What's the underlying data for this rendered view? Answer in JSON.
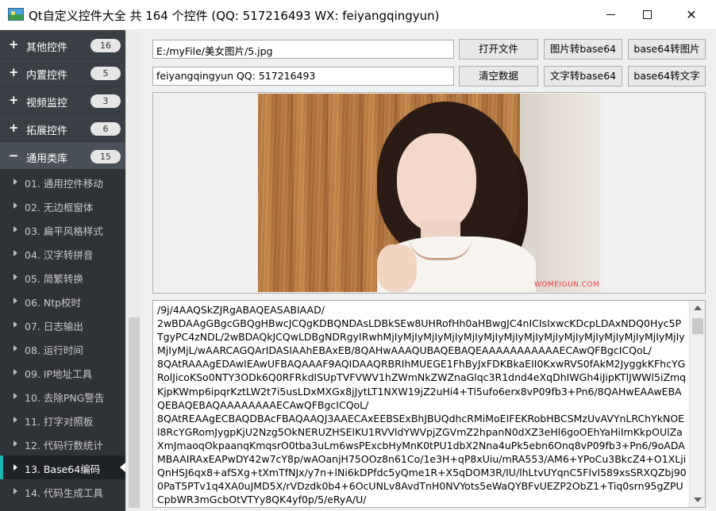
{
  "window": {
    "title": "Qt自定义控件大全 共 164 个控件 (QQ: 517216493 WX: feiyangqingyun)",
    "minimize_label": "–",
    "maximize_label": "□",
    "close_label": "✕"
  },
  "sidebar": {
    "groups": [
      {
        "sign": "+",
        "label": "其他控件",
        "count": "16"
      },
      {
        "sign": "+",
        "label": "内置控件",
        "count": "5"
      },
      {
        "sign": "+",
        "label": "视频监控",
        "count": "3"
      },
      {
        "sign": "+",
        "label": "拓展控件",
        "count": "6"
      },
      {
        "sign": "−",
        "label": "通用类库",
        "count": "15"
      }
    ],
    "items": [
      "01. 通用控件移动",
      "02. 无边框窗体",
      "03. 扁平风格样式",
      "04. 汉字转拼音",
      "05. 简繁转换",
      "06. Ntp校时",
      "07. 日志输出",
      "08. 运行时间",
      "09. IP地址工具",
      "10. 去除PNG警告",
      "11. 打字对照板",
      "12. 代码行数统计",
      "13. Base64编码",
      "14. 代码生成工具"
    ],
    "active_item": "13. Base64编码",
    "accent_color": "#19b6b4"
  },
  "toolbar": {
    "file_path": "E:/myFile/美女图片/5.jpg",
    "text_input": "feiyangqingyun QQ: 517216493",
    "open_file": "打开文件",
    "img_to_base64": "图片转base64",
    "base64_to_img": "base64转图片",
    "clear_data": "清空数据",
    "text_to_base64": "文字转base64",
    "base64_to_text": "base64转文字"
  },
  "preview": {
    "watermark": "WOMEIGUN.COM"
  },
  "output": {
    "text": "/9j/4AAQSkZJRgABAQEASABIAAD/\n2wBDAAgGBgcGBQgHBwcJCQgKDBQNDAsLDBkSEw8UHRofHh0aHBwgJC4nICIsIxwcKDcpLDAxNDQ0Hyc5PTgyPC4zNDL/2wBDAQkJCQwLDBgNDRgyIRwhMjIyMjIyMjIyMjIyMjIyMjIyMjIyMjIyMjIyMjIyMjIyMjIyMjIyMjIyMjIyMjIyMjL/wAARCAGQArIDASIAAhEBAxEB/8QAHwAAAQUBAQEBAQEAAAAAAAAAAAECAwQFBgcICQoL/\n8QAtRAAAgEDAwIEAwUFBAQAAAF9AQIDAAQRBRIhMUEGE1FhByJxFDKBkaEII0KxwRVS0fAkM2JyggkKFhcYGRolJicoKSo0NTY3ODk6Q0RFRkdISUpTVFVWV1hZWmNkZWZnaGlqc3R1dnd4eXqDhIWGh4iJipKTlJWWl5iZmqKjpKWmp6ipqrKztLW2t7i5usLDxMXGx8jJytLT1NXW19jZ2uHi4+Tl5ufo6erx8vP09fb3+Pn6/8QAHwEAAwEBAQEBAQEBAQAAAAAAAAECAwQFBgcICQoL/\n8QAtREAAgECBAQDBAcFBAQAAQJ3AAECAxEEBSExBhJBUQdhcRMiMoEIFEKRobHBCSMzUvAVYnLRChYkNOEl8RcYGRomJygpKjU2Nzg5OkNERUZHSElKU1RVVldYWVpjZGVmZ2hpanN0dXZ3eHl6goOEhYaHiImKkpOUlZaXmJmaoqOkpaanqKmqsrO0tba3uLm6wsPExcbHyMnK0tPU1dbX2Nna4uPk5ebn6Onq8vP09fb3+Pn6/9oADAMBAAIRAxEAPwDY42w7cY8p/wAOanjH75OOz8n61Co/1e3H+qP8xUiu/mRA553/AM6+YPoCu3BkcZ4+O1XLjiQnHSJ6qx8+afSXg+tXmTfNJx/y7n+lNi6kDPfdc5yQme1R+X5qDOM3R/IU/lhLtvUYqnC5FIvI589xsSRXQZbj900PaT5PTv1q4XA0uJMD5X/rVDzdk0b4+6OcUNLv8AvdTnH0NVYots5eWaQYBFvUEZP2ObZ1+Tiq0srn95gZPUCpbWR3mGcbOtVTYy8QK4yf0p/5/eRyA/U/"
  }
}
